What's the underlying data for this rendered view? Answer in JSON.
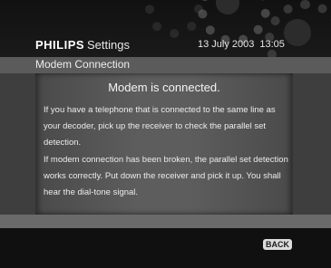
{
  "header": {
    "brand": "PHILIPS",
    "section": "Settings",
    "date": "13 July 2003",
    "time": "13:05"
  },
  "title_bar": {
    "title": "Modem Connection"
  },
  "content": {
    "heading": "Modem is connected.",
    "paragraphs": [
      "If you have a telephone that is connected to the same line as your decoder, pick up the receiver to check the parallel set detection.",
      "If modem connection has been broken, the parallel set detection works correctly. Put down the receiver and pick it up. You shall hear the dial-tone signal."
    ]
  },
  "footer": {
    "back_label": "BACK"
  },
  "icons": {
    "header_decoration": "gears-icon"
  },
  "colors": {
    "background": "#0b0b0b",
    "title_bar": "#5b5b5b",
    "panel": "#5d5d5d",
    "text": "#f0f0f0"
  }
}
